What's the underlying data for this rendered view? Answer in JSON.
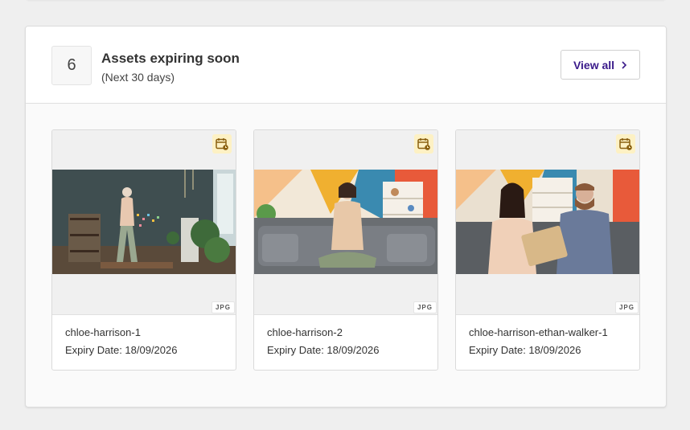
{
  "panel": {
    "count": "6",
    "title": "Assets expiring soon",
    "subtitle": "(Next 30 days)",
    "view_all_label": "View all"
  },
  "assets": [
    {
      "name": "chloe-harrison-1",
      "expiry": "Expiry Date: 18/09/2026",
      "type": "JPG"
    },
    {
      "name": "chloe-harrison-2",
      "expiry": "Expiry Date: 18/09/2026",
      "type": "JPG"
    },
    {
      "name": "chloe-harrison-ethan-walker-1",
      "expiry": "Expiry Date: 18/09/2026",
      "type": "JPG"
    }
  ],
  "icons": {
    "calendar": "calendar-clock-icon",
    "chevron": "chevron-right-icon"
  },
  "colors": {
    "accent": "#3a1a8a",
    "badge_bg": "#fdf1c4",
    "badge_icon": "#8a6010"
  }
}
